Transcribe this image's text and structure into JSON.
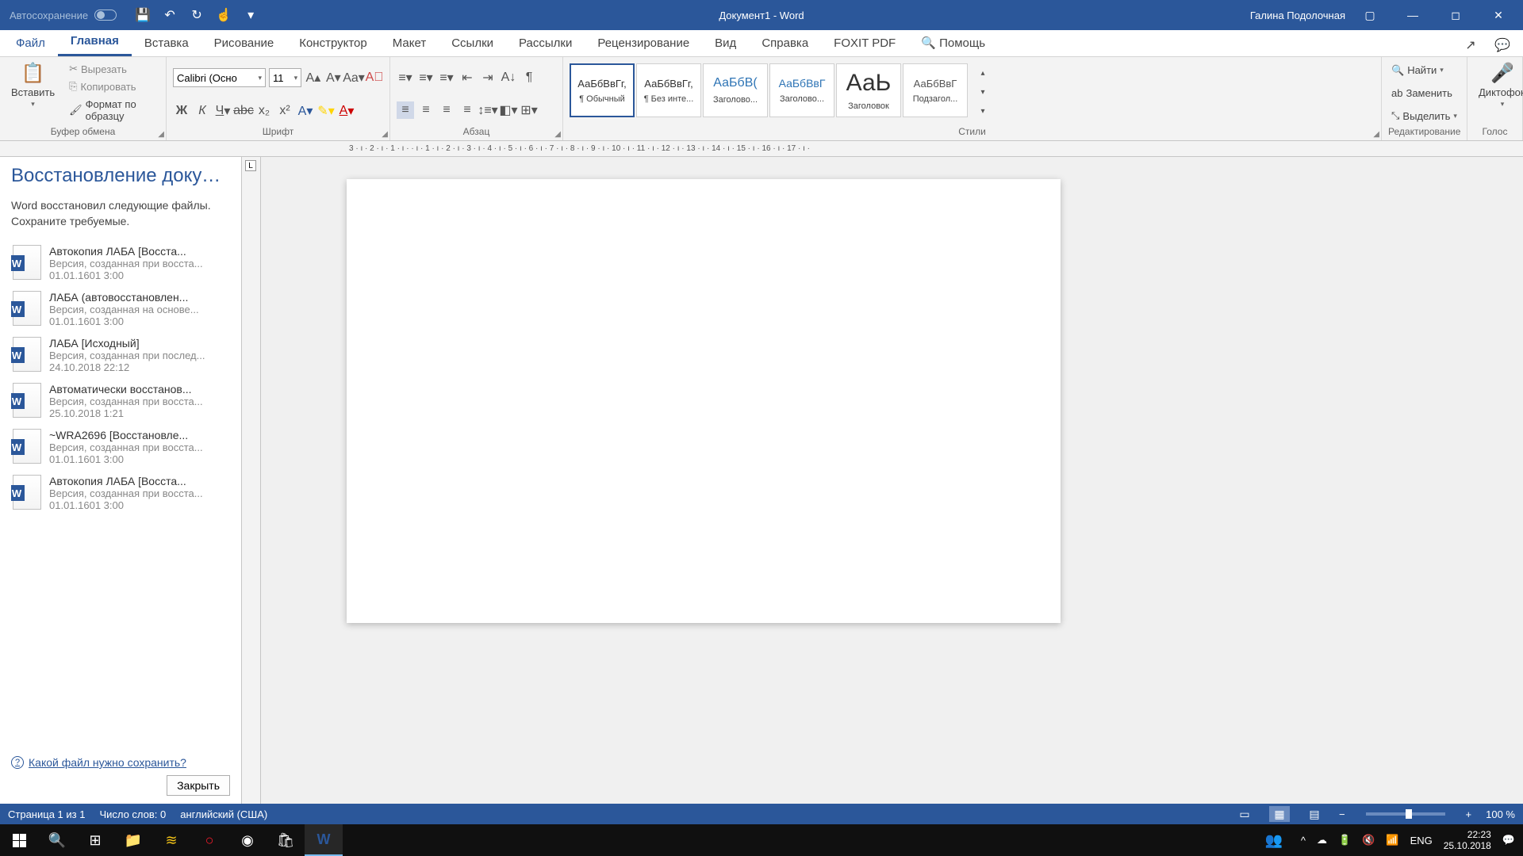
{
  "titlebar": {
    "autosave_label": "Автосохранение",
    "doc_title": "Документ1  -  Word",
    "user_name": "Галина Подолочная"
  },
  "tabs": {
    "file": "Файл",
    "home": "Главная",
    "insert": "Вставка",
    "draw": "Рисование",
    "design": "Конструктор",
    "layout": "Макет",
    "references": "Ссылки",
    "mailings": "Рассылки",
    "review": "Рецензирование",
    "view": "Вид",
    "help": "Справка",
    "foxit": "FOXIT PDF",
    "tell_me": "Помощь"
  },
  "ribbon": {
    "clipboard": {
      "paste": "Вставить",
      "cut": "Вырезать",
      "copy": "Копировать",
      "format_painter": "Формат по образцу",
      "group_label": "Буфер обмена"
    },
    "font": {
      "name": "Calibri (Осно",
      "size": "11",
      "group_label": "Шрифт"
    },
    "paragraph": {
      "group_label": "Абзац"
    },
    "styles": {
      "items": [
        {
          "preview": "АаБбВвГг,",
          "label": "¶ Обычный"
        },
        {
          "preview": "АаБбВвГг,",
          "label": "¶ Без инте..."
        },
        {
          "preview": "АаБбВ(",
          "label": "Заголово..."
        },
        {
          "preview": "АаБбВвГ",
          "label": "Заголово..."
        },
        {
          "preview": "АаЬ",
          "label": "Заголовок"
        },
        {
          "preview": "АаБбВвГ",
          "label": "Подзагол..."
        }
      ],
      "group_label": "Стили"
    },
    "editing": {
      "find": "Найти",
      "replace": "Заменить",
      "select": "Выделить",
      "group_label": "Редактирование"
    },
    "voice": {
      "dictate": "Диктофон",
      "group_label": "Голос"
    }
  },
  "recovery": {
    "title": "Восстановление докумен...",
    "desc": "Word восстановил следующие файлы. Сохраните требуемые.",
    "items": [
      {
        "title": "Автокопия ЛАБА  [Восста...",
        "sub": "Версия, созданная при восста...",
        "time": "01.01.1601 3:00"
      },
      {
        "title": "ЛАБА  (автовосстановлен...",
        "sub": "Версия, созданная на основе...",
        "time": "01.01.1601 3:00"
      },
      {
        "title": "ЛАБА  [Исходный]",
        "sub": "Версия, созданная при послед...",
        "time": "24.10.2018 22:12"
      },
      {
        "title": "Автоматически восстанов...",
        "sub": "Версия, созданная при восста...",
        "time": "25.10.2018 1:21"
      },
      {
        "title": "~WRA2696  [Восстановле...",
        "sub": "Версия, созданная при восста...",
        "time": "01.01.1601 3:00"
      },
      {
        "title": "Автокопия ЛАБА  [Восста...",
        "sub": "Версия, созданная при восста...",
        "time": "01.01.1601 3:00"
      }
    ],
    "help_link": "Какой файл нужно сохранить?",
    "close": "Закрыть"
  },
  "statusbar": {
    "page": "Страница 1 из 1",
    "words": "Число слов: 0",
    "lang": "английский (США)",
    "zoom": "100 %"
  },
  "taskbar": {
    "lang": "ENG",
    "time": "22:23",
    "date": "25.10.2018"
  },
  "ruler_marks": "3 · ı · 2 · ı · 1 · ı ·  · ı · 1 · ı · 2 · ı · 3 · ı · 4 · ı · 5 · ı · 6 · ı · 7 · ı · 8 · ı · 9 · ı · 10 · ı · 11 · ı · 12 · ı · 13 · ı · 14 · ı · 15 · ı · 16 · ı · 17 · ı ·"
}
